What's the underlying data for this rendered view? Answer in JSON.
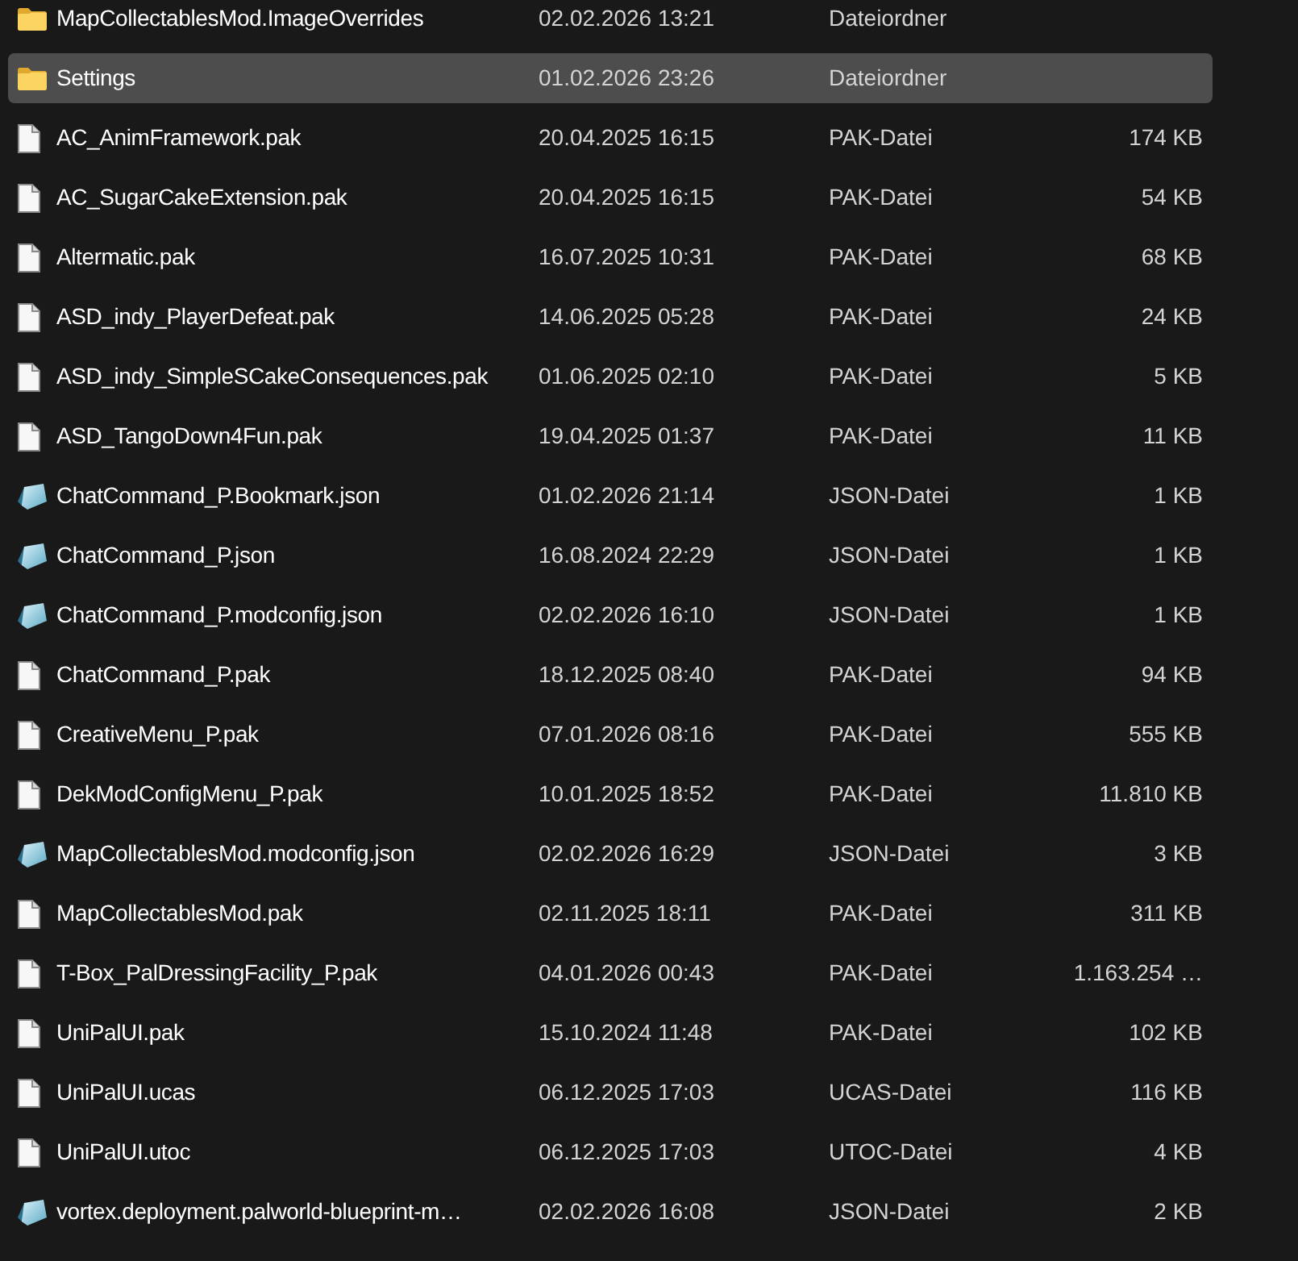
{
  "files": [
    {
      "name": "MapCollectablesMod.ImageOverrides",
      "kind": "folder",
      "modified": "02.02.2026 13:21",
      "type": "Dateiordner",
      "selected": false
    },
    {
      "name": "Settings",
      "kind": "folder",
      "modified": "01.02.2026 23:26",
      "type": "Dateiordner",
      "selected": true
    },
    {
      "name": "AC_AnimFramework.pak",
      "kind": "file",
      "modified": "20.04.2025 16:15",
      "type": "PAK-Datei",
      "size": "174 KB",
      "selected": false
    },
    {
      "name": "AC_SugarCakeExtension.pak",
      "kind": "file",
      "modified": "20.04.2025 16:15",
      "type": "PAK-Datei",
      "size": "54 KB",
      "selected": false
    },
    {
      "name": "Altermatic.pak",
      "kind": "file",
      "modified": "16.07.2025 10:31",
      "type": "PAK-Datei",
      "size": "68 KB",
      "selected": false
    },
    {
      "name": "ASD_indy_PlayerDefeat.pak",
      "kind": "file",
      "modified": "14.06.2025 05:28",
      "type": "PAK-Datei",
      "size": "24 KB",
      "selected": false
    },
    {
      "name": "ASD_indy_SimpleSCakeConsequences.pak",
      "kind": "file",
      "modified": "01.06.2025 02:10",
      "type": "PAK-Datei",
      "size": "5 KB",
      "selected": false
    },
    {
      "name": "ASD_TangoDown4Fun.pak",
      "kind": "file",
      "modified": "19.04.2025 01:37",
      "type": "PAK-Datei",
      "size": "11 KB",
      "selected": false
    },
    {
      "name": "ChatCommand_P.Bookmark.json",
      "kind": "json",
      "modified": "01.02.2026 21:14",
      "type": "JSON-Datei",
      "size": "1 KB",
      "selected": false
    },
    {
      "name": "ChatCommand_P.json",
      "kind": "json",
      "modified": "16.08.2024 22:29",
      "type": "JSON-Datei",
      "size": "1 KB",
      "selected": false
    },
    {
      "name": "ChatCommand_P.modconfig.json",
      "kind": "json",
      "modified": "02.02.2026 16:10",
      "type": "JSON-Datei",
      "size": "1 KB",
      "selected": false
    },
    {
      "name": "ChatCommand_P.pak",
      "kind": "file",
      "modified": "18.12.2025 08:40",
      "type": "PAK-Datei",
      "size": "94 KB",
      "selected": false
    },
    {
      "name": "CreativeMenu_P.pak",
      "kind": "file",
      "modified": "07.01.2026 08:16",
      "type": "PAK-Datei",
      "size": "555 KB",
      "selected": false
    },
    {
      "name": "DekModConfigMenu_P.pak",
      "kind": "file",
      "modified": "10.01.2025 18:52",
      "type": "PAK-Datei",
      "size": "11.810 KB",
      "selected": false
    },
    {
      "name": "MapCollectablesMod.modconfig.json",
      "kind": "json",
      "modified": "02.02.2026 16:29",
      "type": "JSON-Datei",
      "size": "3 KB",
      "selected": false
    },
    {
      "name": "MapCollectablesMod.pak",
      "kind": "file",
      "modified": "02.11.2025 18:11",
      "type": "PAK-Datei",
      "size": "311 KB",
      "selected": false
    },
    {
      "name": "T-Box_PalDressingFacility_P.pak",
      "kind": "file",
      "modified": "04.01.2026 00:43",
      "type": "PAK-Datei",
      "size": "1.163.254 …",
      "selected": false
    },
    {
      "name": "UniPalUI.pak",
      "kind": "file",
      "modified": "15.10.2024 11:48",
      "type": "PAK-Datei",
      "size": "102 KB",
      "selected": false
    },
    {
      "name": "UniPalUI.ucas",
      "kind": "file",
      "modified": "06.12.2025 17:03",
      "type": "UCAS-Datei",
      "size": "116 KB",
      "selected": false
    },
    {
      "name": "UniPalUI.utoc",
      "kind": "file",
      "modified": "06.12.2025 17:03",
      "type": "UTOC-Datei",
      "size": "4 KB",
      "selected": false
    },
    {
      "name": "vortex.deployment.palworld-blueprint-m…",
      "kind": "json",
      "modified": "02.02.2026 16:08",
      "type": "JSON-Datei",
      "size": "2 KB",
      "selected": false
    }
  ]
}
